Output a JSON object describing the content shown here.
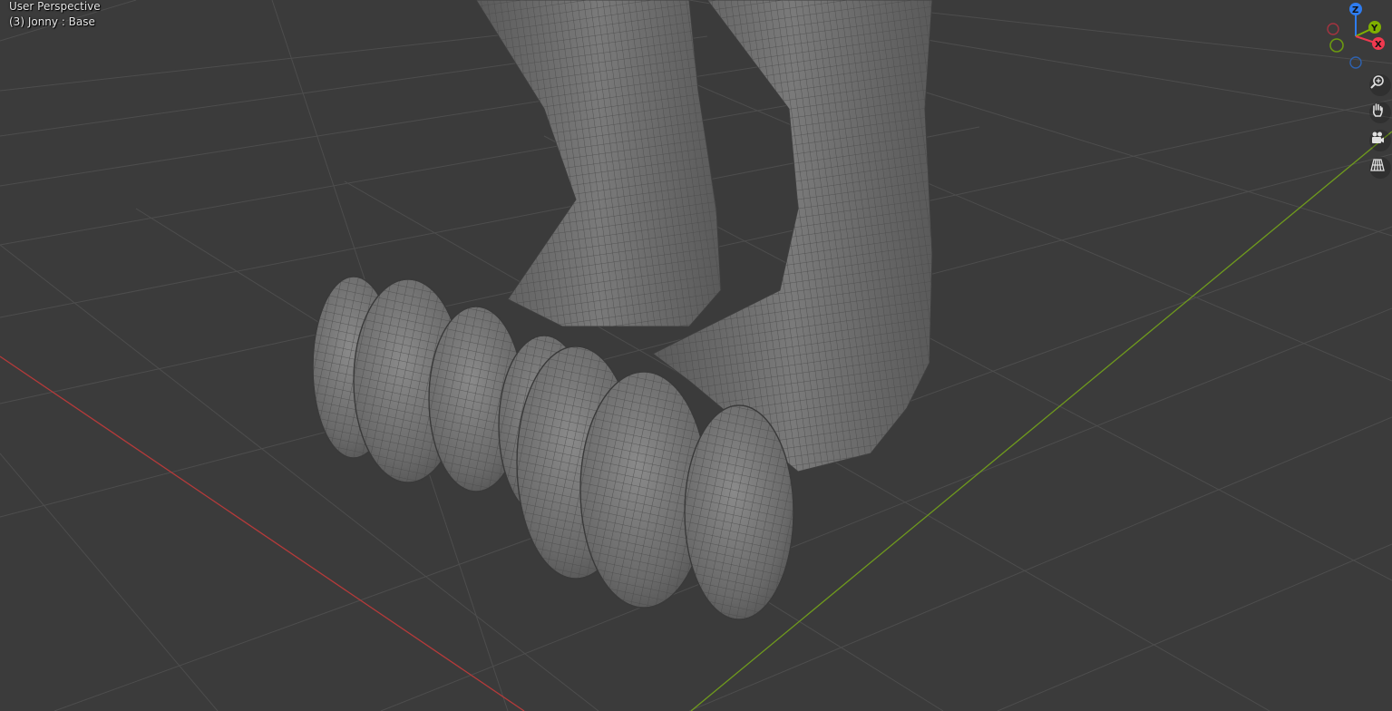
{
  "viewport": {
    "view_name": "User Perspective",
    "object_info": "(3) Jonny : Base"
  },
  "gizmo": {
    "axes": [
      {
        "label": "Z",
        "color": "#2e7cf0"
      },
      {
        "label": "Y",
        "color": "#7fb000"
      },
      {
        "label": "X",
        "color": "#f0394f"
      }
    ]
  },
  "nav_buttons": [
    {
      "name": "zoom-icon"
    },
    {
      "name": "pan-hand-icon"
    },
    {
      "name": "camera-view-icon"
    },
    {
      "name": "perspective-grid-icon"
    }
  ],
  "colors": {
    "background": "#3b3b3b",
    "grid": "#4c4c4c",
    "x_axis_line": "#b53a3a",
    "y_axis_line": "#6f9a1d",
    "mesh": "#6e6e6e"
  }
}
